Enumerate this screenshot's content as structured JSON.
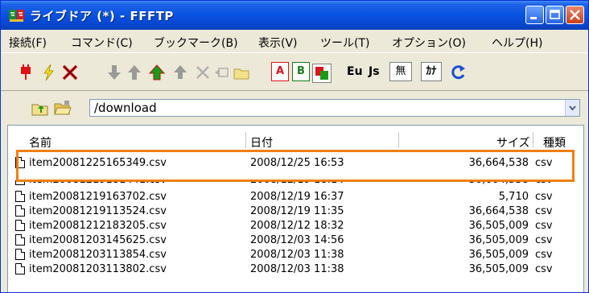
{
  "window": {
    "title": "ライブドア (*) - FFFTP"
  },
  "menubar": [
    "接続(F)",
    "コマンド(C)",
    "ブックマーク(B)",
    "表示(V)",
    "ツール(T)",
    "オプション(O)",
    "ヘルプ(H)"
  ],
  "toolbar": {
    "transfer_ascii": "A",
    "transfer_binary": "B",
    "kanji_euc": "Eu",
    "kanji_jis": "Js",
    "no_convert": "無",
    "kana": "ｶﾅ"
  },
  "path": {
    "value": "/download"
  },
  "columns": {
    "name": "名前",
    "date": "日付",
    "size": "サイズ",
    "type": "種類"
  },
  "files": [
    {
      "name": "item20081225165349.csv",
      "date": "2008/12/25 16:53",
      "size": "36,664,538",
      "type": "csv"
    },
    {
      "name": "item20081219181441.csv",
      "date": "2008/12/19 18:14",
      "size": "36,664,538",
      "type": "csv"
    },
    {
      "name": "item20081219163702.csv",
      "date": "2008/12/19 16:37",
      "size": "5,710",
      "type": "csv"
    },
    {
      "name": "item20081219113524.csv",
      "date": "2008/12/19 11:35",
      "size": "36,664,538",
      "type": "csv"
    },
    {
      "name": "item20081212183205.csv",
      "date": "2008/12/12 18:32",
      "size": "36,505,009",
      "type": "csv"
    },
    {
      "name": "item20081203145625.csv",
      "date": "2008/12/03 14:56",
      "size": "36,505,009",
      "type": "csv"
    },
    {
      "name": "item20081203113854.csv",
      "date": "2008/12/03 11:38",
      "size": "36,505,009",
      "type": "csv"
    },
    {
      "name": "item20081203113802.csv",
      "date": "2008/12/03 11:38",
      "size": "36,505,009",
      "type": "csv"
    }
  ],
  "colors": {
    "titlebar": "#0a54e3",
    "highlight": "#f07f12",
    "accent_green": "#1a9b1a",
    "accent_red": "#e0101a"
  }
}
